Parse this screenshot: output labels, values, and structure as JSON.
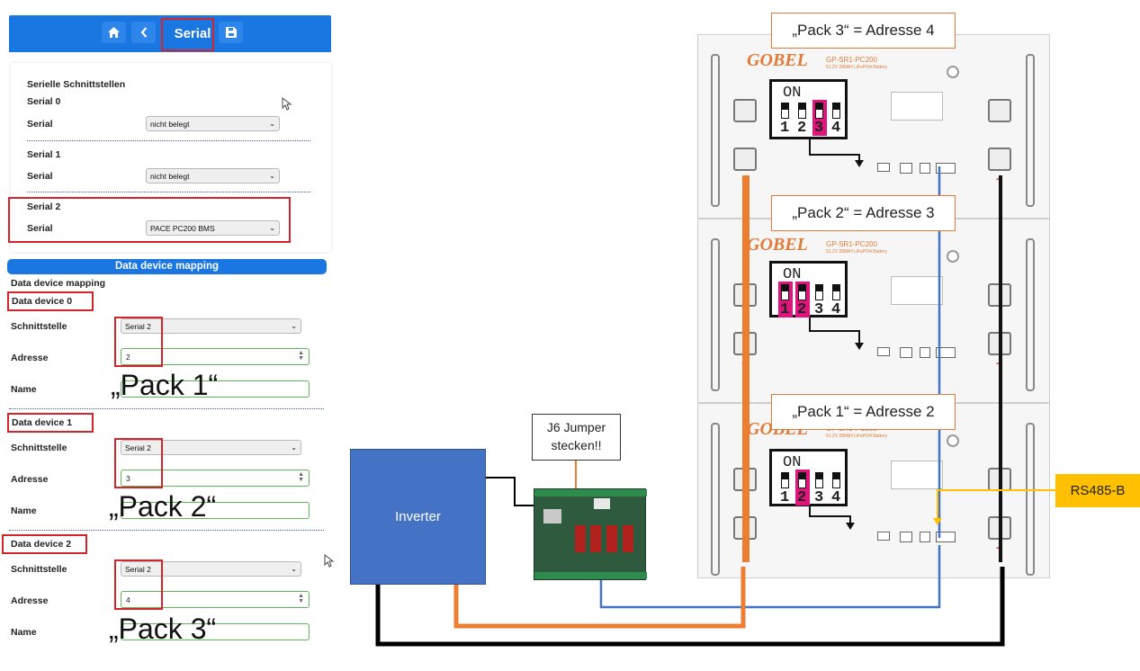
{
  "nav": {
    "title": "Serial"
  },
  "serial_card": {
    "heading": "Serielle Schnittstellen",
    "ports": [
      {
        "name": "Serial 0",
        "field_label": "Serial",
        "value": "nicht belegt"
      },
      {
        "name": "Serial 1",
        "field_label": "Serial",
        "value": "nicht belegt"
      },
      {
        "name": "Serial 2",
        "field_label": "Serial",
        "value": "PACE PC200 BMS"
      }
    ]
  },
  "mapping": {
    "header": "Data device mapping",
    "subheader": "Data device mapping",
    "devices": [
      {
        "title": "Data device 0",
        "iface_label": "Schnittstelle",
        "iface_value": "Serial 2",
        "addr_label": "Adresse",
        "addr_value": "2",
        "name_label": "Name",
        "name_value": "„Pack 1“"
      },
      {
        "title": "Data device 1",
        "iface_label": "Schnittstelle",
        "iface_value": "Serial 2",
        "addr_label": "Adresse",
        "addr_value": "3",
        "name_label": "Name",
        "name_value": "„Pack 2“"
      },
      {
        "title": "Data device 2",
        "iface_label": "Schnittstelle",
        "iface_value": "Serial 2",
        "addr_label": "Adresse",
        "addr_value": "4",
        "name_label": "Name",
        "name_value": "„Pack 3“"
      }
    ]
  },
  "diagram": {
    "inverter_label": "Inverter",
    "jumper_note": "J6 Jumper\nstecken!!",
    "rs485_label": "RS485-B",
    "packs": [
      {
        "callout": "„Pack 3“ = Adresse 4",
        "brand": "GOBEL",
        "model": "GP-SR1-PC200",
        "spec": "51.2V 280AH LiFePO4 Battery",
        "dip_on": "ON",
        "dip_nums": [
          "1",
          "2",
          "3",
          "4"
        ],
        "active": [
          3
        ]
      },
      {
        "callout": "„Pack 2“ = Adresse 3",
        "brand": "GOBEL",
        "model": "GP-SR1-PC200",
        "spec": "51.2V 280AH LiFePO4 Battery",
        "dip_on": "ON",
        "dip_nums": [
          "1",
          "2",
          "3",
          "4"
        ],
        "active": [
          1,
          2
        ]
      },
      {
        "callout": "„Pack 1“ = Adresse 2",
        "brand": "GOBEL",
        "model": "GP-SR1-PC200",
        "spec": "51.2V 280AH LiFePO4 Battery",
        "dip_on": "ON",
        "dip_nums": [
          "1",
          "2",
          "3",
          "4"
        ],
        "active": [
          2
        ]
      }
    ],
    "terminal_plus": "+",
    "terminal_minus": "−"
  },
  "colors": {
    "accent_blue": "#1a76e0",
    "highlight_red": "#d3262b",
    "callout_orange": "#e07b39",
    "dip_pink": "#e0157b",
    "inverter_blue": "#4472c4",
    "rs485_yellow": "#ffc000",
    "cable_orange": "#ed7d31",
    "cable_blue": "#4472c4",
    "cable_black": "#000000"
  },
  "icons": [
    "home-icon",
    "back-icon",
    "save-icon",
    "mouse-cursor-icon"
  ]
}
